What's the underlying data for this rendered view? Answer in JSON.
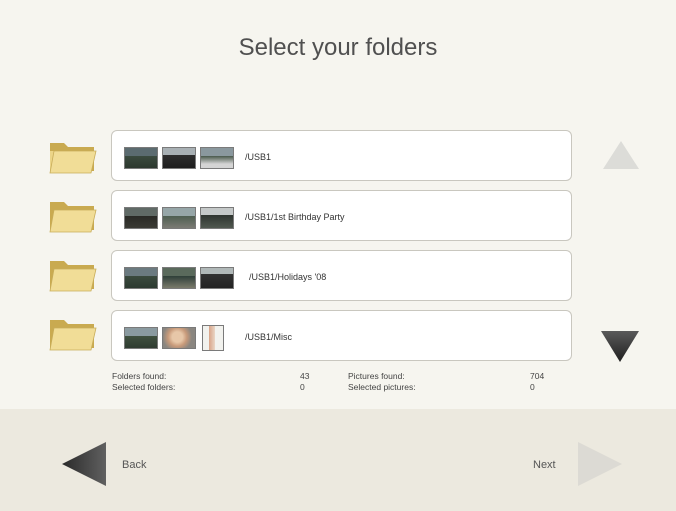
{
  "title": "Select your folders",
  "folders": [
    {
      "path": "/USB1",
      "thumbs": [
        "car-photo",
        "car-photo",
        "car-photo"
      ]
    },
    {
      "path": "/USB1/1st Birthday Party",
      "thumbs": [
        "car-photo",
        "car-photo",
        "car-photo"
      ]
    },
    {
      "path": "/USB1/Holidays '08",
      "thumbs": [
        "car-photo",
        "car-photo",
        "car-photo"
      ]
    },
    {
      "path": "/USB1/Misc",
      "thumbs": [
        "car-photo",
        "portrait-photo",
        "document-photo"
      ]
    }
  ],
  "stats": {
    "folders_found_label": "Folders found:",
    "folders_found": "43",
    "selected_folders_label": "Selected folders:",
    "selected_folders": "0",
    "pictures_found_label": "Pictures found:",
    "pictures_found": "704",
    "selected_pictures_label": "Selected pictures:",
    "selected_pictures": "0"
  },
  "nav": {
    "back_label": "Back",
    "next_label": "Next"
  },
  "icons": {
    "folder": "folder-icon",
    "scroll_up": "triangle-up-icon",
    "scroll_down": "triangle-down-icon",
    "back": "triangle-left-icon",
    "next": "triangle-right-icon"
  },
  "colors": {
    "background": "#f6f5ef",
    "footer": "#ece9df",
    "folder": "#e8cf7e",
    "arrow_active": "#3a3a3a",
    "arrow_disabled": "#dcdcd8"
  }
}
